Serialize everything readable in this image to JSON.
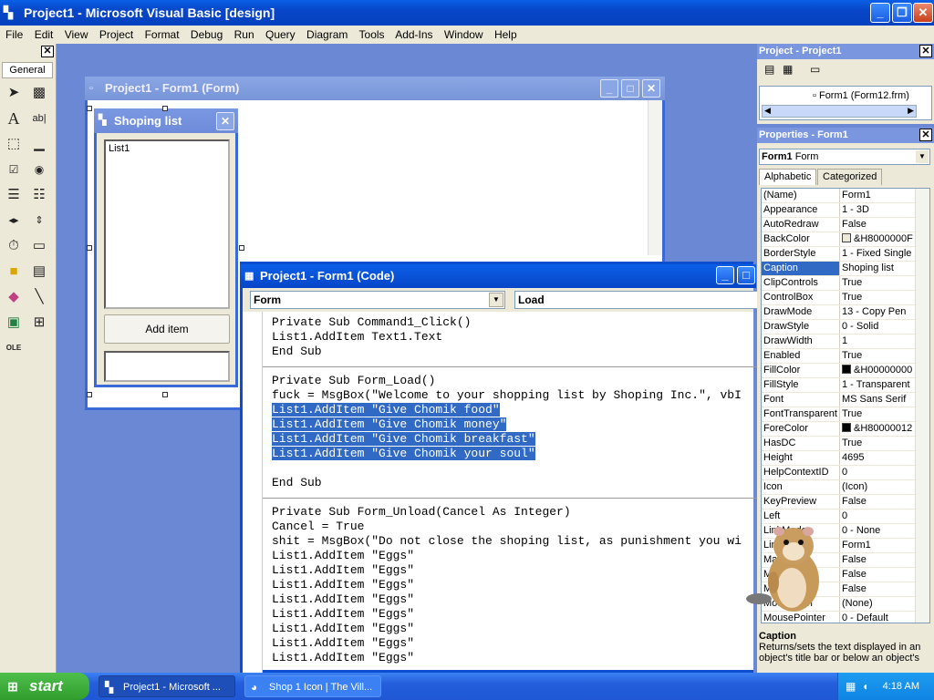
{
  "app": {
    "title": "Project1 - Microsoft Visual Basic [design]",
    "window_buttons": [
      "_",
      "❐",
      "✕"
    ]
  },
  "menu": [
    "File",
    "Edit",
    "View",
    "Project",
    "Format",
    "Debug",
    "Run",
    "Query",
    "Diagram",
    "Tools",
    "Add-Ins",
    "Window",
    "Help"
  ],
  "toolbox": {
    "tab": "General",
    "close": "✕",
    "tools": [
      "pointer",
      "picturebox",
      "label",
      "textbox",
      "frame",
      "commandbutton",
      "checkbox",
      "optionbutton",
      "combobox",
      "listbox",
      "hscrollbar",
      "vscrollbar",
      "timer",
      "drivelistbox",
      "dirlistbox",
      "filelistbox",
      "shape",
      "line",
      "image",
      "data",
      "ole"
    ]
  },
  "form_designer": {
    "title": "Project1 - Form1 (Form)"
  },
  "shop_form": {
    "title": "Shoping list",
    "list_item": "List1",
    "button": "Add item"
  },
  "code_window": {
    "title": "Project1 - Form1 (Code)",
    "object_combo": "Form",
    "proc_combo": "Load",
    "lines": [
      {
        "t": "Private Sub Command1_Click()",
        "s": false
      },
      {
        "t": "List1.AddItem Text1.Text",
        "s": false
      },
      {
        "t": "End Sub",
        "s": false
      },
      {
        "t": "",
        "s": false,
        "sep": true
      },
      {
        "t": "Private Sub Form_Load()",
        "s": false
      },
      {
        "t": "fuck = MsgBox(\"Welcome to your shopping list by Shoping Inc.\", vbI",
        "s": false
      },
      {
        "t": "List1.AddItem \"Give Chomik food\"",
        "s": true
      },
      {
        "t": "List1.AddItem \"Give Chomik money\"",
        "s": true
      },
      {
        "t": "List1.AddItem \"Give Chomik breakfast\"",
        "s": true
      },
      {
        "t": "List1.AddItem \"Give Chomik your soul\"",
        "s": true
      },
      {
        "t": "",
        "s": false
      },
      {
        "t": "End Sub",
        "s": false
      },
      {
        "t": "",
        "s": false,
        "sep": true
      },
      {
        "t": "Private Sub Form_Unload(Cancel As Integer)",
        "s": false
      },
      {
        "t": "Cancel = True",
        "s": false
      },
      {
        "t": "shit = MsgBox(\"Do not close the shoping list, as punishment you wi",
        "s": false
      },
      {
        "t": "List1.AddItem \"Eggs\"",
        "s": false
      },
      {
        "t": "List1.AddItem \"Eggs\"",
        "s": false
      },
      {
        "t": "List1.AddItem \"Eggs\"",
        "s": false
      },
      {
        "t": "List1.AddItem \"Eggs\"",
        "s": false
      },
      {
        "t": "List1.AddItem \"Eggs\"",
        "s": false
      },
      {
        "t": "List1.AddItem \"Eggs\"",
        "s": false
      },
      {
        "t": "List1.AddItem \"Eggs\"",
        "s": false
      },
      {
        "t": "List1.AddItem \"Eggs\"",
        "s": false
      }
    ]
  },
  "project_explorer": {
    "title": "Project - Project1",
    "node": "Form1 (Form12.frm)"
  },
  "properties": {
    "title": "Properties - Form1",
    "object": "Form1",
    "object_type": "Form",
    "tabs": [
      "Alphabetic",
      "Categorized"
    ],
    "rows": [
      {
        "n": "(Name)",
        "v": "Form1"
      },
      {
        "n": "Appearance",
        "v": "1 - 3D"
      },
      {
        "n": "AutoRedraw",
        "v": "False"
      },
      {
        "n": "BackColor",
        "v": "&H8000000F",
        "sw": "#ece9d8"
      },
      {
        "n": "BorderStyle",
        "v": "1 - Fixed Single"
      },
      {
        "n": "Caption",
        "v": "Shoping list",
        "hl": true
      },
      {
        "n": "ClipControls",
        "v": "True"
      },
      {
        "n": "ControlBox",
        "v": "True"
      },
      {
        "n": "DrawMode",
        "v": "13 - Copy Pen"
      },
      {
        "n": "DrawStyle",
        "v": "0 - Solid"
      },
      {
        "n": "DrawWidth",
        "v": "1"
      },
      {
        "n": "Enabled",
        "v": "True"
      },
      {
        "n": "FillColor",
        "v": "&H00000000",
        "sw": "#000000"
      },
      {
        "n": "FillStyle",
        "v": "1 - Transparent"
      },
      {
        "n": "Font",
        "v": "MS Sans Serif"
      },
      {
        "n": "FontTransparent",
        "v": "True"
      },
      {
        "n": "ForeColor",
        "v": "&H80000012",
        "sw": "#000000"
      },
      {
        "n": "HasDC",
        "v": "True"
      },
      {
        "n": "Height",
        "v": "4695"
      },
      {
        "n": "HelpContextID",
        "v": "0"
      },
      {
        "n": "Icon",
        "v": "(Icon)"
      },
      {
        "n": "KeyPreview",
        "v": "False"
      },
      {
        "n": "Left",
        "v": "0"
      },
      {
        "n": "LinkMode",
        "v": "0 - None"
      },
      {
        "n": "LinkTopic",
        "v": "Form1"
      },
      {
        "n": "MaxButton",
        "v": "False"
      },
      {
        "n": "MDIChild",
        "v": "False"
      },
      {
        "n": "MinButton",
        "v": "False"
      },
      {
        "n": "MouseIcon",
        "v": "(None)"
      },
      {
        "n": "MousePointer",
        "v": "0 - Default"
      }
    ],
    "desc_title": "Caption",
    "desc_text": "Returns/sets the text displayed in an object's title bar or below an object's"
  },
  "taskbar": {
    "start": "start",
    "tasks": [
      "Project1 - Microsoft ...",
      "Shop 1 Icon | The Vill..."
    ],
    "clock": "4:18 AM"
  }
}
